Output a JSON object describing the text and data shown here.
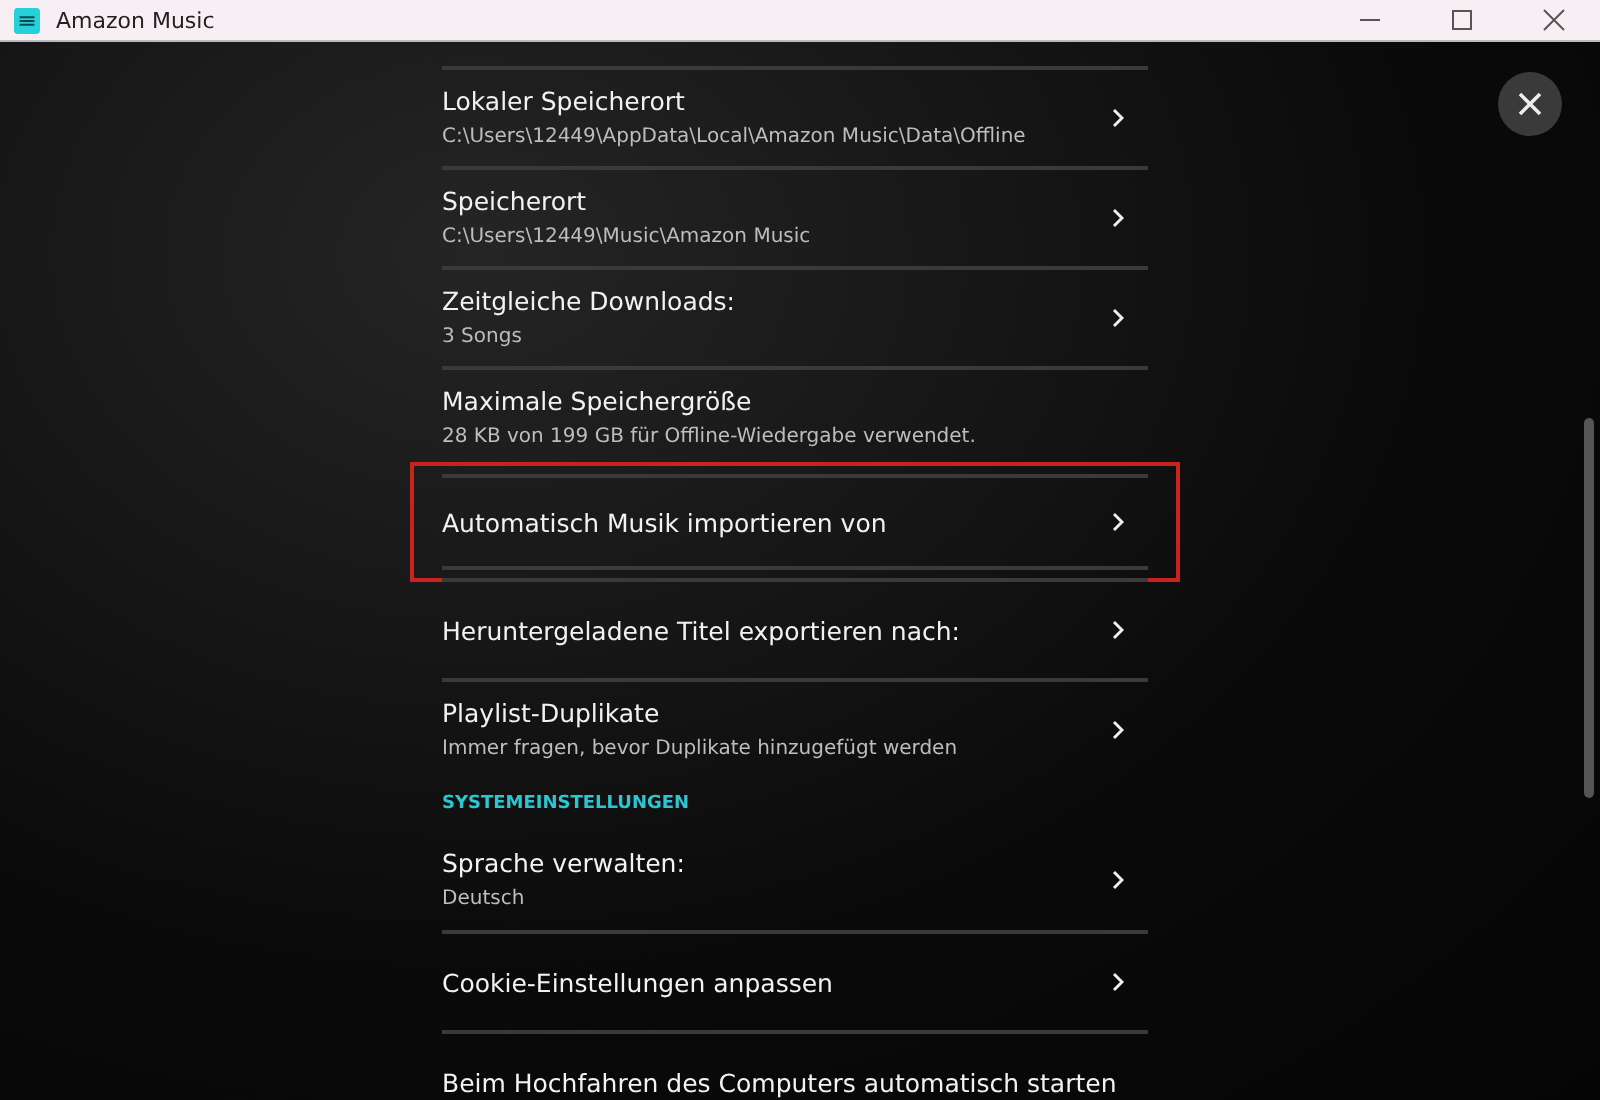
{
  "window": {
    "title": "Amazon Music"
  },
  "settings": [
    {
      "kind": "item",
      "title": "Lokaler Speicherort",
      "subtitle": "C:\\Users\\12449\\AppData\\Local\\Amazon Music\\Data\\Offline",
      "chevron": true,
      "highlighted": false
    },
    {
      "kind": "item",
      "title": "Speicherort",
      "subtitle": "C:\\Users\\12449\\Music\\Amazon Music",
      "chevron": true,
      "highlighted": false
    },
    {
      "kind": "item",
      "title": "Zeitgleiche Downloads:",
      "subtitle": "3 Songs",
      "chevron": true,
      "highlighted": false
    },
    {
      "kind": "item",
      "title": "Maximale Speichergröße",
      "subtitle": "28 KB von 199 GB für Offline-Wiedergabe verwendet.",
      "chevron": false,
      "highlighted": false
    },
    {
      "kind": "item",
      "title": "Automatisch Musik importieren von",
      "chevron": true,
      "highlighted": true
    },
    {
      "kind": "item",
      "title": "Heruntergeladene Titel exportieren nach:",
      "chevron": true,
      "highlighted": false
    },
    {
      "kind": "item",
      "title": "Playlist-Duplikate",
      "subtitle": "Immer fragen, bevor Duplikate hinzugefügt werden",
      "chevron": true,
      "highlighted": false
    },
    {
      "kind": "section",
      "title": "SYSTEMEINSTELLUNGEN"
    },
    {
      "kind": "item",
      "title": "Sprache verwalten:",
      "subtitle": "Deutsch",
      "chevron": true,
      "highlighted": false
    },
    {
      "kind": "item",
      "title": "Cookie-Einstellungen anpassen",
      "chevron": true,
      "highlighted": false
    },
    {
      "kind": "item",
      "title": "Beim Hochfahren des Computers automatisch starten",
      "chevron": false,
      "highlighted": false
    }
  ]
}
